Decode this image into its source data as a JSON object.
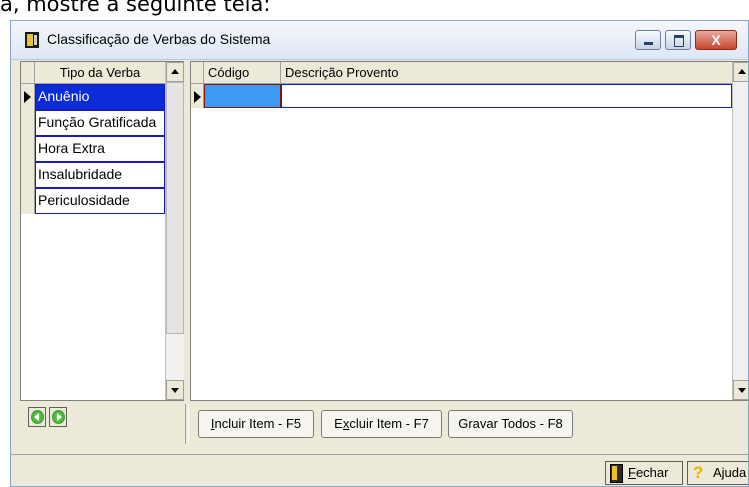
{
  "doc_text": "a, mostre a seguinte tela:",
  "window": {
    "title": "Classificação de Verbas do Sistema",
    "close_glyph": "X"
  },
  "left_grid": {
    "header": "Tipo da Verba",
    "rows": [
      "Anuênio",
      "Função Gratificada",
      "Hora Extra",
      "Insalubridade",
      "Periculosidade"
    ]
  },
  "right_grid": {
    "col_codigo": "Código",
    "col_descricao": "Descrição Provento"
  },
  "buttons": {
    "incluir_first": "I",
    "incluir_rest": "ncluir Item - F5",
    "excluir_first": "E",
    "excluir_ul": "x",
    "excluir_rest": "cluir Item - F7",
    "gravar": "Gravar Todos - F8"
  },
  "status": {
    "fechar_first": "F",
    "fechar_rest": "echar",
    "ajuda": "Ajuda"
  },
  "colors": {
    "selection": "#0a2bd6",
    "active_cell": "#3d9af2",
    "grid_border": "#1a1ab8"
  }
}
